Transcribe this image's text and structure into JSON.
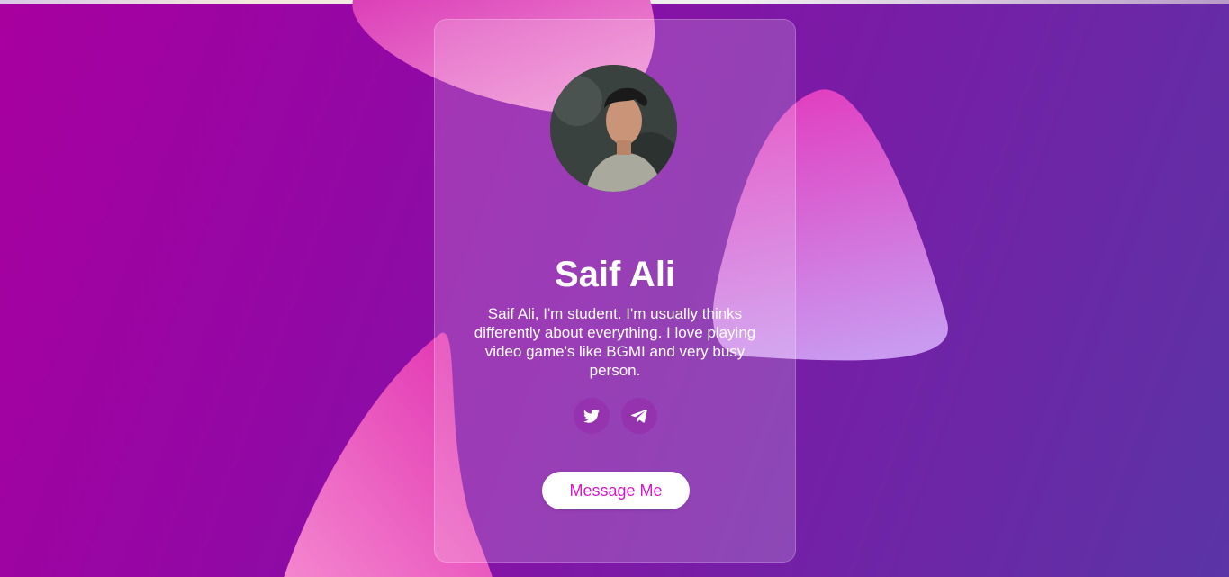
{
  "profile": {
    "name": "Saif Ali",
    "bio": "Saif Ali, I'm student. I'm usually thinks differently about everything. I love playing video game's like BGMI and very busy person."
  },
  "social": [
    {
      "icon": "twitter-icon"
    },
    {
      "icon": "telegram-icon"
    }
  ],
  "actions": {
    "message_label": "Message Me"
  },
  "colors": {
    "background_start": "#a8009f",
    "background_end": "#5b34a6",
    "button_text": "#d21ac6",
    "blob_pink": "#e83fb5"
  }
}
